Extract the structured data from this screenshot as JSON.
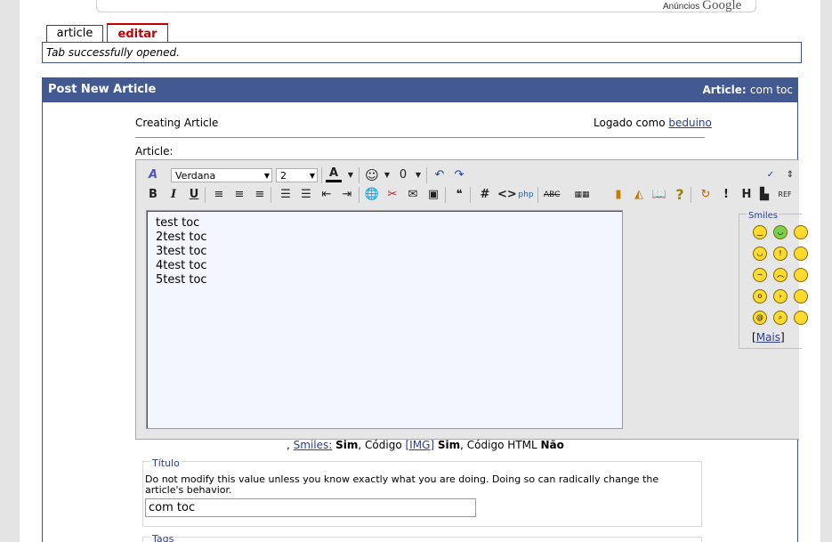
{
  "ads": {
    "label": "Anúncios",
    "brand": "Google"
  },
  "tabs": [
    {
      "label": "article"
    },
    {
      "label": "editar"
    }
  ],
  "notice": "Tab successfully opened.",
  "panel": {
    "title": "Post New Article",
    "article_label": "Article:",
    "article_value": "com toc"
  },
  "header": {
    "creating": "Creating Article",
    "logged_prefix": "Logado como",
    "user": "beduino"
  },
  "editor": {
    "label": "Article:",
    "font": "Verdana",
    "size": "2",
    "content_lines": [
      "test toc",
      "2test toc",
      "3test toc",
      "4test toc",
      "5test toc"
    ],
    "smiles_label": "Smiles",
    "more_label": "Mais"
  },
  "status": {
    "lead": ",",
    "smiles_link": "Smiles:",
    "smiles_value": "Sim",
    "code_label": ", Código",
    "img_link": "[IMG]",
    "img_value": "Sim",
    "html_label": ", Código HTML",
    "html_value": "Não"
  },
  "title_field": {
    "legend": "Título",
    "help": "Do not modify this value unless you know exactly what you are doing. Doing so can radically change the article's behavior.",
    "value": "com toc"
  },
  "tags_field": {
    "legend": "Tags"
  },
  "colors": {
    "accent": "#435991",
    "tab_active": "#c00000",
    "editor_bg": "#f4f6ff"
  }
}
